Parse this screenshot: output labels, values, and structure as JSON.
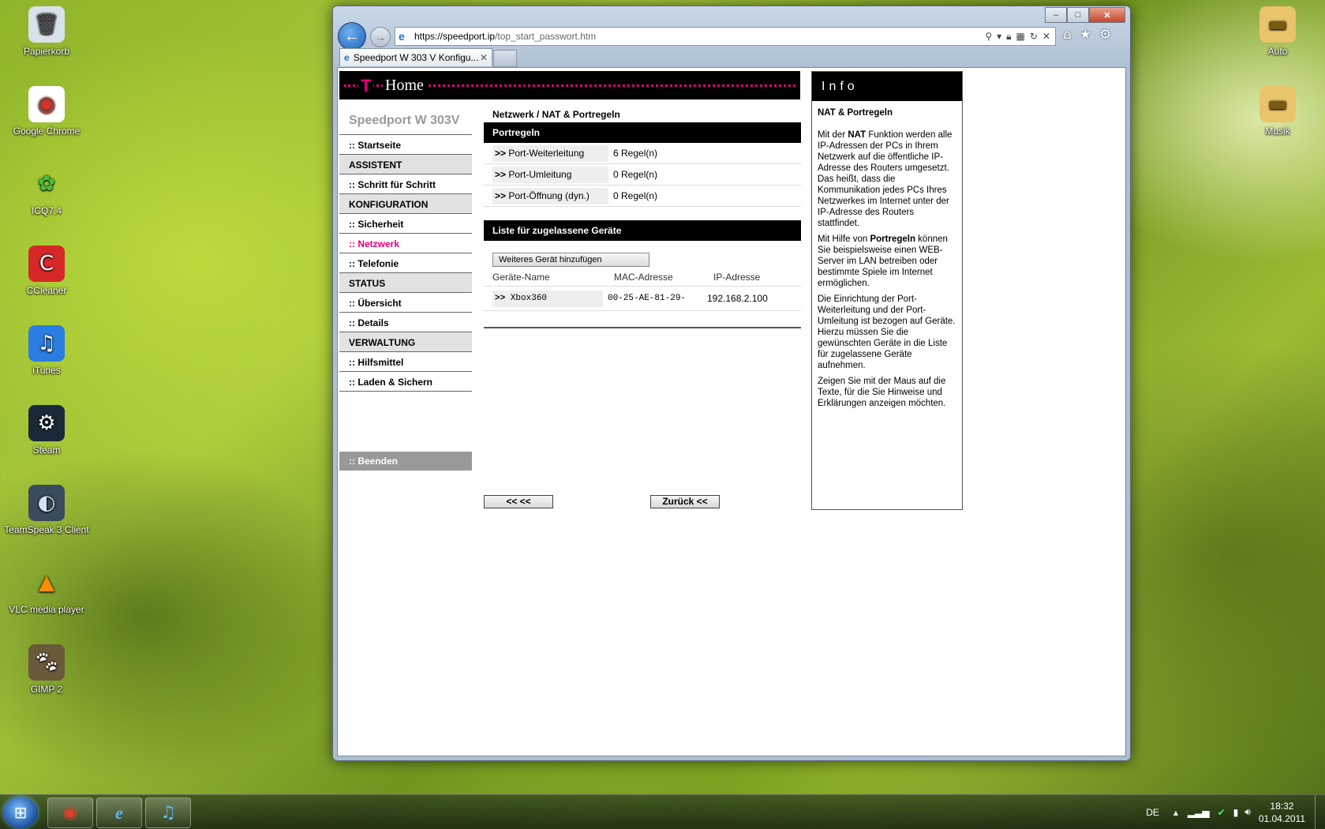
{
  "desktop": {
    "left_icons": [
      {
        "label": "Papierkorb",
        "icon": "recycle-bin"
      },
      {
        "label": "Google Chrome",
        "icon": "chrome"
      },
      {
        "label": "ICQ7.4",
        "icon": "icq-flower"
      },
      {
        "label": "CCleaner",
        "icon": "ccleaner"
      },
      {
        "label": "iTunes",
        "icon": "itunes-note"
      },
      {
        "label": "Steam",
        "icon": "steam"
      },
      {
        "label": "TeamSpeak 3 Client",
        "icon": "teamspeak"
      },
      {
        "label": "VLC media player",
        "icon": "vlc-cone"
      },
      {
        "label": "GIMP 2",
        "icon": "gimp"
      }
    ],
    "right_icons": [
      {
        "label": "Auto",
        "icon": "folder"
      },
      {
        "label": "Musik",
        "icon": "folder"
      }
    ]
  },
  "browser": {
    "url_host": "https://speedport.ip",
    "url_path": "/top_start_passwort.htm",
    "tab_title": "Speedport W 303 V Konfigu...",
    "caption": {
      "minimize": "–",
      "maximize": "□",
      "close": "✕"
    }
  },
  "router": {
    "banner_logo": "T",
    "banner_home": "Home",
    "brand": "Speedport W 303V",
    "nav": [
      {
        "type": "link",
        "label": ":: Startseite"
      },
      {
        "type": "section",
        "label": "ASSISTENT"
      },
      {
        "type": "link",
        "label": ":: Schritt für Schritt"
      },
      {
        "type": "section",
        "label": "KONFIGURATION"
      },
      {
        "type": "link",
        "label": ":: Sicherheit"
      },
      {
        "type": "link",
        "label": ":: Netzwerk",
        "active": true
      },
      {
        "type": "link",
        "label": ":: Telefonie"
      },
      {
        "type": "section",
        "label": "STATUS"
      },
      {
        "type": "link",
        "label": ":: Übersicht"
      },
      {
        "type": "link",
        "label": ":: Details"
      },
      {
        "type": "section",
        "label": "VERWALTUNG"
      },
      {
        "type": "link",
        "label": ":: Hilfsmittel"
      },
      {
        "type": "link",
        "label": ":: Laden & Sichern"
      }
    ],
    "exit": ":: Beenden",
    "breadcrumb": "Netzwerk / NAT & Portregeln",
    "portrules_title": "Portregeln",
    "portrules": [
      {
        "name": "Port-Weiterleitung",
        "value": "6 Regel(n)"
      },
      {
        "name": "Port-Umleitung",
        "value": "0 Regel(n)"
      },
      {
        "name": "Port-Öffnung (dyn.)",
        "value": "0 Regel(n)"
      }
    ],
    "arrow": ">>",
    "devices_title": "Liste für zugelassene Geräte",
    "add_device_button": "Weiteres Gerät hinzufügen",
    "device_columns": [
      "Geräte-Name",
      "MAC-Adresse",
      "IP-Adresse"
    ],
    "devices": [
      {
        "name": "Xbox360",
        "mac": "00-25-AE-81-29-",
        "ip": "192.168.2.100"
      }
    ],
    "btn_back_left": "<< <<",
    "btn_back": "Zurück <<",
    "info_title": "Info",
    "info_heading": "NAT & Portregeln",
    "info_p1_a": "Mit der ",
    "info_p1_b": "NAT",
    "info_p1_c": " Funktion werden alle IP-Adressen der PCs in Ihrem Netzwerk auf die öffentliche IP-Adresse des Routers umgesetzt. Das heißt, dass die Kommunikation jedes PCs Ihres Netzwerkes im Internet unter der IP-Adresse des Routers stattfindet.",
    "info_p2_a": "Mit Hilfe von ",
    "info_p2_b": "Portregeln",
    "info_p2_c": " können Sie beispielsweise einen WEB-Server im LAN betreiben oder bestimmte Spiele im Internet ermöglichen.",
    "info_p3": "Die Einrichtung der Port-Weiterleitung und der Port-Umleitung ist bezogen auf Geräte. Hierzu müssen Sie die gewünschten Geräte in die Liste für zugelassene Geräte aufnehmen.",
    "info_p4": "Zeigen Sie mit der Maus auf die Texte, für die Sie Hinweise und Erklärungen anzeigen möchten."
  },
  "taskbar": {
    "language": "DE",
    "time": "18:32",
    "date": "01.04.2011",
    "pinned": [
      "chrome",
      "internet-explorer",
      "itunes"
    ]
  }
}
